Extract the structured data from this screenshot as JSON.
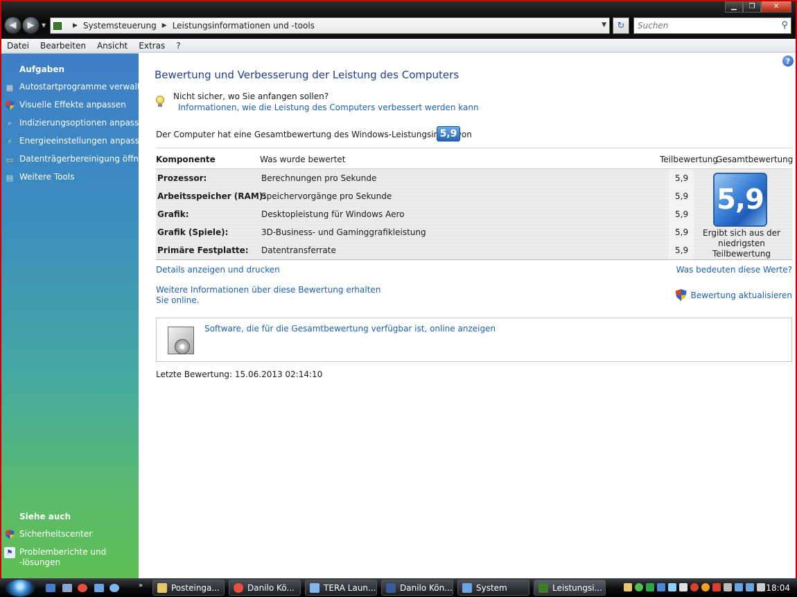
{
  "window": {
    "address_parts": [
      "Systemsteuerung",
      "Leistungsinformationen und -tools"
    ],
    "search_placeholder": "Suchen"
  },
  "menu": [
    "Datei",
    "Bearbeiten",
    "Ansicht",
    "Extras",
    "?"
  ],
  "sidebar": {
    "tasks_heading": "Aufgaben",
    "tasks": [
      {
        "label": "Autostartprogramme verwalten",
        "icon": "startup-programs-icon"
      },
      {
        "label": "Visuelle Effekte anpassen",
        "icon": "shield-icon"
      },
      {
        "label": "Indizierungsoptionen anpassen",
        "icon": "indexing-icon"
      },
      {
        "label": "Energieeinstellungen anpassen",
        "icon": "power-icon"
      },
      {
        "label": "Datenträgerbereinigung öffnen",
        "icon": "disk-cleanup-icon"
      },
      {
        "label": "Weitere Tools",
        "icon": "tools-icon"
      }
    ],
    "see_also_heading": "Siehe auch",
    "see_also": [
      {
        "label": "Sicherheitscenter",
        "icon": "security-center-icon"
      },
      {
        "label": "Problemberichte und",
        "label2": "-lösungen",
        "icon": "problem-reports-icon"
      }
    ]
  },
  "main": {
    "title": "Bewertung und Verbesserung der Leistung des Computers",
    "unsure_text": "Nicht sicher, wo Sie anfangen sollen?",
    "unsure_link": "Informationen, wie die Leistung des Computers verbessert werden kann",
    "overall_text": "Der Computer hat eine Gesamtbewertung des Windows-Leistungsindex von",
    "overall_score": "5,9",
    "table": {
      "headers": {
        "component": "Komponente",
        "what": "Was wurde bewertet",
        "sub": "Teilbewertung",
        "total": "Gesamtbewertung"
      },
      "rows": [
        {
          "component": "Prozessor:",
          "what": "Berechnungen pro Sekunde",
          "sub": "5,9"
        },
        {
          "component": "Arbeitsspeicher (RAM):",
          "what": "Speichervorgänge pro Sekunde",
          "sub": "5,9"
        },
        {
          "component": "Grafik:",
          "what": "Desktopleistung für Windows Aero",
          "sub": "5,9"
        },
        {
          "component": "Grafik (Spiele):",
          "what": "3D-Business- und Gaminggrafikleistung",
          "sub": "5,9"
        },
        {
          "component": "Primäre Festplatte:",
          "what": "Datentransferrate",
          "sub": "5,9"
        }
      ],
      "total_score": "5,9",
      "total_note": "Ergibt sich aus der niedrigsten Teilbewertung"
    },
    "details_link": "Details anzeigen und drucken",
    "meaning_link": "Was bedeuten diese Werte?",
    "more_info_link_1": "Weitere Informationen über diese Bewertung erhalten",
    "more_info_link_2": "Sie online.",
    "update_link": "Bewertung aktualisieren",
    "software_link": "Software, die für die Gesamtbewertung verfügbar ist, online anzeigen",
    "last_rating": "Letzte Bewertung: 15.06.2013 02:14:10"
  },
  "taskbar": {
    "buttons": [
      {
        "label": "Posteinga...",
        "icon_color": "#e8c66a"
      },
      {
        "label": "Danilo Kö...",
        "icon_color": "#e94e3c"
      },
      {
        "label": "TERA Laun...",
        "icon_color": "#7fb6ee"
      },
      {
        "label": "Danilo Kön...",
        "icon_color": "#3b5998"
      },
      {
        "label": "System",
        "icon_color": "#6ba3e0"
      },
      {
        "label": "Leistungsi...",
        "icon_color": "#3a7b2c"
      }
    ],
    "clock": "18:04"
  }
}
